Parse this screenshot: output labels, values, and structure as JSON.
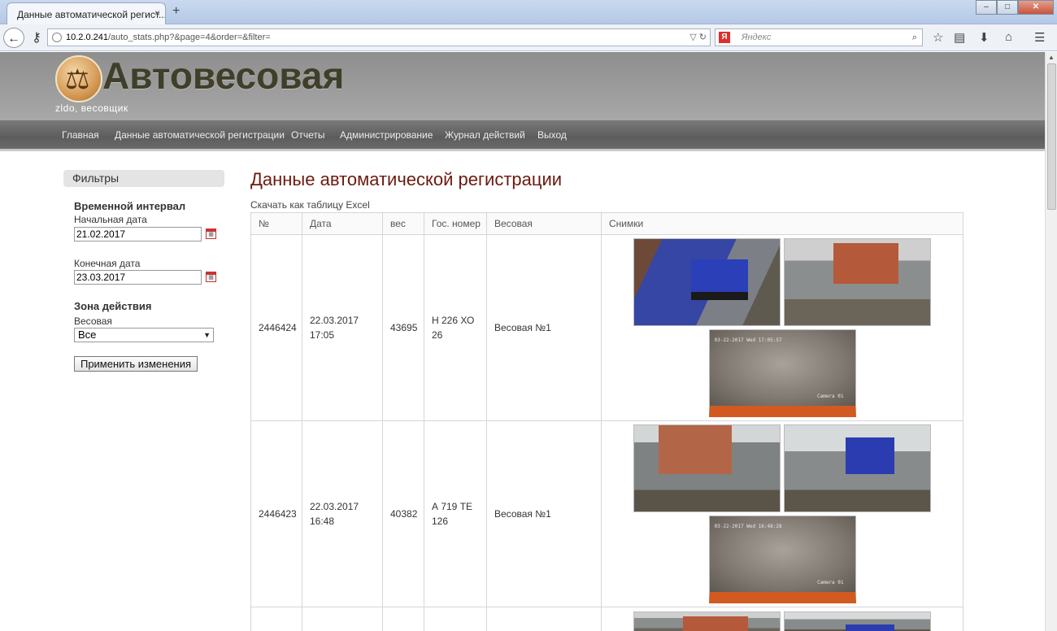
{
  "browser": {
    "tab_title": "Данные автоматической регист...",
    "tab_close": "×",
    "new_tab": "+",
    "url_host": "10.2.0.241",
    "url_path": "/auto_stats.php?&page=4&order=&filter=",
    "search_placeholder": "Яндекс",
    "search_logo": "Я"
  },
  "site": {
    "title": "Автовесовая",
    "user": "zldo, весовщик"
  },
  "menu": {
    "items": [
      "Главная",
      "Данные автоматической регистрации",
      "Отчеты",
      "Администрирование",
      "Журнал действий",
      "Выход"
    ]
  },
  "filters": {
    "title": "Фильтры",
    "interval_heading": "Временной интервал",
    "start_label": "Начальная дата",
    "start_value": "21.02.2017",
    "end_label": "Конечная дата",
    "end_value": "23.03.2017",
    "zone_heading": "Зона действия",
    "scale_label": "Весовая",
    "scale_value": "Все",
    "apply_button": "Применить изменения"
  },
  "main": {
    "title": "Данные автоматической регистрации",
    "excel_link": "Скачать как таблицу Excel",
    "columns": [
      "№",
      "Дата",
      "вес",
      "Гос. номер",
      "Весовая",
      "Снимки"
    ],
    "rows": [
      {
        "id": "2446424",
        "date": "22.03.2017",
        "time": "17:05",
        "weight": "43695",
        "plate_1": "Н 226 ХО",
        "plate_2": "26",
        "scale": "Весовая №1",
        "cam_timestamp": "03-22-2017 Wed 17:05:57",
        "cam_label": "Camera 01"
      },
      {
        "id": "2446423",
        "date": "22.03.2017",
        "time": "16:48",
        "weight": "40382",
        "plate_1": "А 719 ТЕ",
        "plate_2": "126",
        "scale": "Весовая №1",
        "cam_timestamp": "03-22-2017 Wed 16:48:28",
        "cam_label": "Camera 01"
      }
    ]
  }
}
